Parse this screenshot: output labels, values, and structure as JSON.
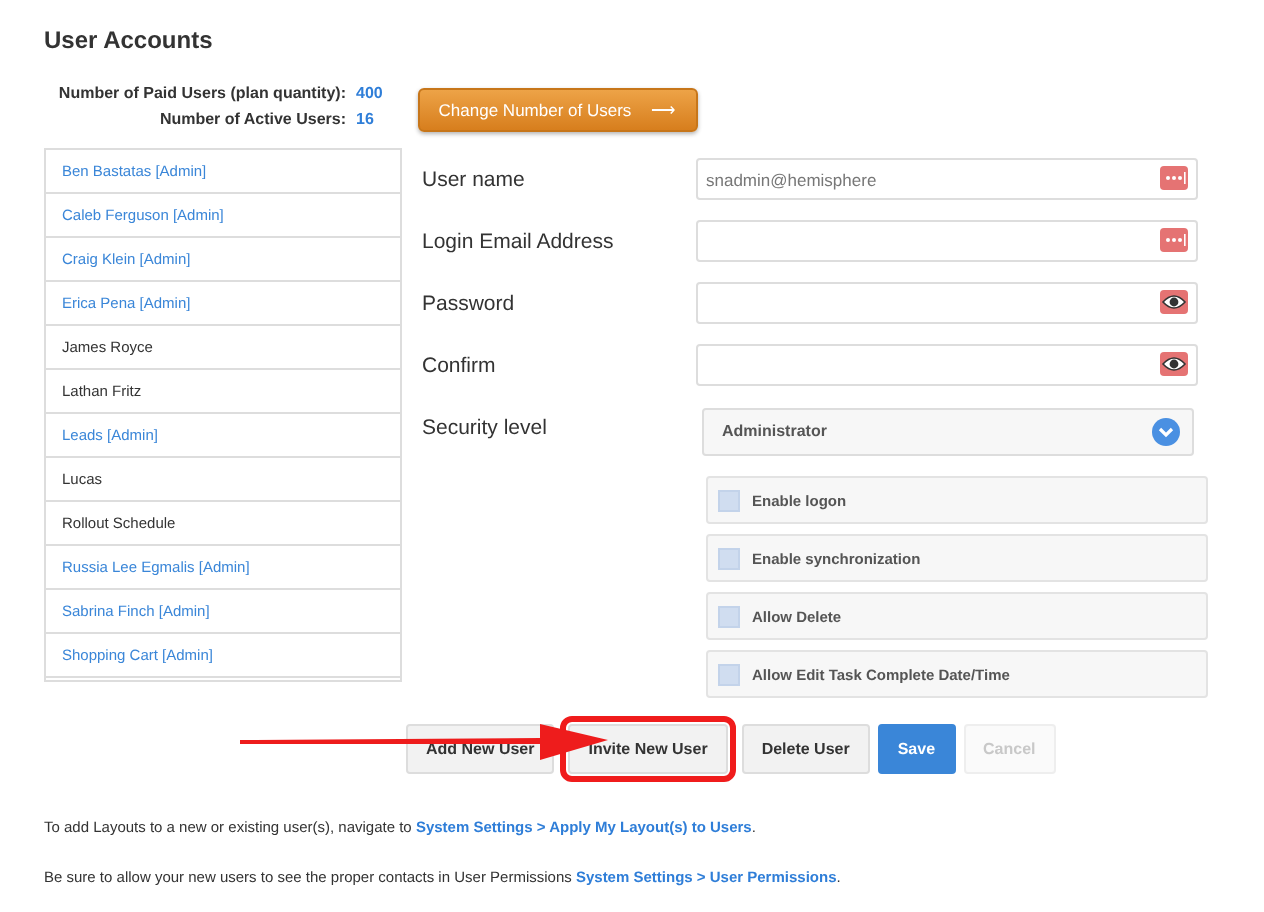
{
  "title": "User Accounts",
  "stats": [
    {
      "label": "Number of Paid Users (plan quantity):",
      "value": "400"
    },
    {
      "label": "Number of Active Users:",
      "value": "16"
    }
  ],
  "change_button": {
    "label": "Change Number of Users",
    "arrow": "⟶"
  },
  "users": [
    {
      "name": "Ben Bastatas [Admin]",
      "kind": "admin"
    },
    {
      "name": "Caleb Ferguson [Admin]",
      "kind": "admin"
    },
    {
      "name": "Craig Klein [Admin]",
      "kind": "admin"
    },
    {
      "name": "Erica Pena [Admin]",
      "kind": "admin"
    },
    {
      "name": "James Royce",
      "kind": "user"
    },
    {
      "name": "Lathan Fritz",
      "kind": "user"
    },
    {
      "name": "Leads [Admin]",
      "kind": "admin"
    },
    {
      "name": "Lucas",
      "kind": "user"
    },
    {
      "name": "Rollout Schedule",
      "kind": "user"
    },
    {
      "name": "Russia Lee Egmalis [Admin]",
      "kind": "admin"
    },
    {
      "name": "Sabrina Finch [Admin]",
      "kind": "admin"
    },
    {
      "name": "Shopping Cart [Admin]",
      "kind": "admin"
    }
  ],
  "fields": [
    {
      "label": "User name",
      "value": "snadmin@hemisphere",
      "kind": "text"
    },
    {
      "label": "Login Email Address",
      "kind": "text"
    },
    {
      "label": "Password",
      "kind": "secret"
    },
    {
      "label": "Confirm",
      "kind": "secret"
    }
  ],
  "security": {
    "label": "Security level",
    "value": "Administrator"
  },
  "options": [
    {
      "label": "Enable logon",
      "checked": false
    },
    {
      "label": "Enable synchronization",
      "checked": false
    },
    {
      "label": "Allow Delete",
      "checked": false
    },
    {
      "label": "Allow Edit Task Complete Date/Time",
      "checked": false
    }
  ],
  "buttons": [
    {
      "label": "Add New User",
      "kind": "default"
    },
    {
      "label": "Invite New User",
      "kind": "highlighted"
    },
    {
      "label": "Delete User",
      "kind": "default"
    },
    {
      "label": "Save",
      "kind": "primary"
    },
    {
      "label": "Cancel",
      "kind": "disabled"
    }
  ],
  "notes": [
    {
      "text": "To add Layouts to a new or existing user(s), navigate to",
      "link": "System Settings > Apply My Layout(s) to Users",
      "end": "."
    },
    {
      "text": "Be sure to allow your new users to see the proper contacts in User Permissions",
      "link": "System Settings > User Permissions",
      "end": "."
    }
  ]
}
